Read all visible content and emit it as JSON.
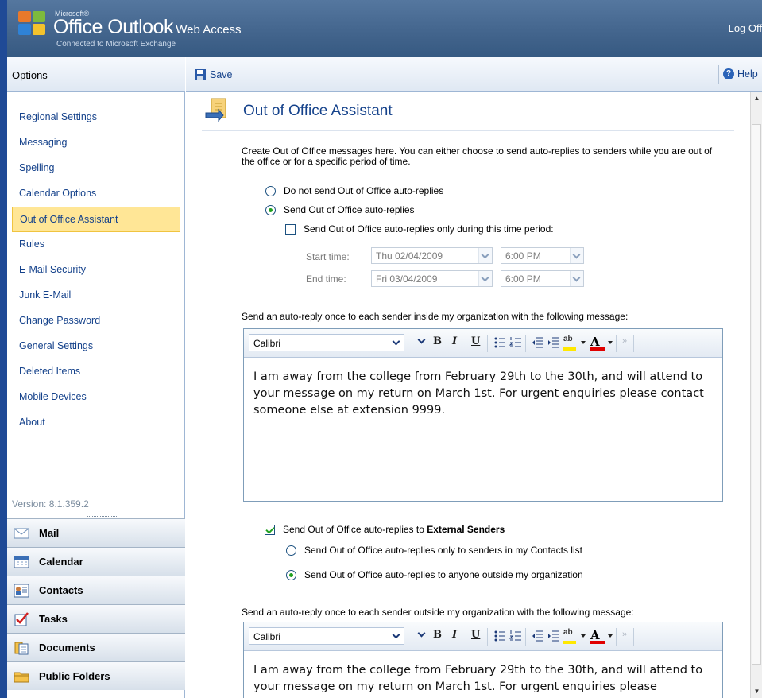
{
  "header": {
    "brand_ms": "Microsoft®",
    "brand_office_outlook": "Office Outlook",
    "brand_web_access": "Web Access",
    "brand_sub": "Connected to Microsoft Exchange",
    "log_off": "Log Off"
  },
  "sidebar": {
    "title": "Options",
    "items": [
      {
        "label": "Regional Settings"
      },
      {
        "label": "Messaging"
      },
      {
        "label": "Spelling"
      },
      {
        "label": "Calendar Options"
      },
      {
        "label": "Out of Office Assistant",
        "active": true
      },
      {
        "label": "Rules"
      },
      {
        "label": "E-Mail Security"
      },
      {
        "label": "Junk E-Mail"
      },
      {
        "label": "Change Password"
      },
      {
        "label": "General Settings"
      },
      {
        "label": "Deleted Items"
      },
      {
        "label": "Mobile Devices"
      },
      {
        "label": "About"
      }
    ],
    "version": "Version: 8.1.359.2"
  },
  "modules": [
    {
      "label": "Mail",
      "icon": "mail-icon"
    },
    {
      "label": "Calendar",
      "icon": "calendar-icon"
    },
    {
      "label": "Contacts",
      "icon": "contacts-icon"
    },
    {
      "label": "Tasks",
      "icon": "tasks-icon"
    },
    {
      "label": "Documents",
      "icon": "documents-icon"
    },
    {
      "label": "Public Folders",
      "icon": "public-folders-icon"
    }
  ],
  "toolbar": {
    "save_label": "Save",
    "help_label": "Help"
  },
  "page": {
    "title": "Out of Office Assistant",
    "intro": "Create Out of Office messages here. You can either choose to send auto-replies to senders while you are out of the office or for a specific period of time.",
    "radio_do_not_send": "Do not send Out of Office auto-replies",
    "radio_send": "Send Out of Office auto-replies",
    "check_time_period": "Send Out of Office auto-replies only during this time period:",
    "start_time_label": "Start time:",
    "end_time_label": "End time:",
    "start_date": "Thu 02/04/2009",
    "start_time": "6:00 PM",
    "end_date": "Fri 03/04/2009",
    "end_time": "6:00 PM",
    "internal_label": "Send an auto-reply once to each sender inside my organization with the following message:",
    "external_check_prefix": "Send Out of Office auto-replies to ",
    "external_check_bold": "External Senders",
    "radio_contacts_only": "Send Out of Office auto-replies only to senders in my Contacts list",
    "radio_anyone": "Send Out of Office auto-replies to anyone outside my organization",
    "external_label": "Send an auto-reply once to each sender outside my organization with the following message:"
  },
  "editor_internal": {
    "font": "Calibri",
    "message": "I am away from the college from February 29th to the 30th, and will attend to your message on my return on March 1st. For urgent enquiries please contact someone else at extension 9999."
  },
  "editor_external": {
    "font": "Calibri",
    "message": "I am away from the college from February 29th to the 30th, and will attend to your message on my return on March 1st. For urgent enquiries please"
  },
  "colors": {
    "accent": "#15428b",
    "header": "#3f6189",
    "active_item": "#ffe696",
    "highlight": "#ffe800",
    "font_color": "#e00000"
  }
}
